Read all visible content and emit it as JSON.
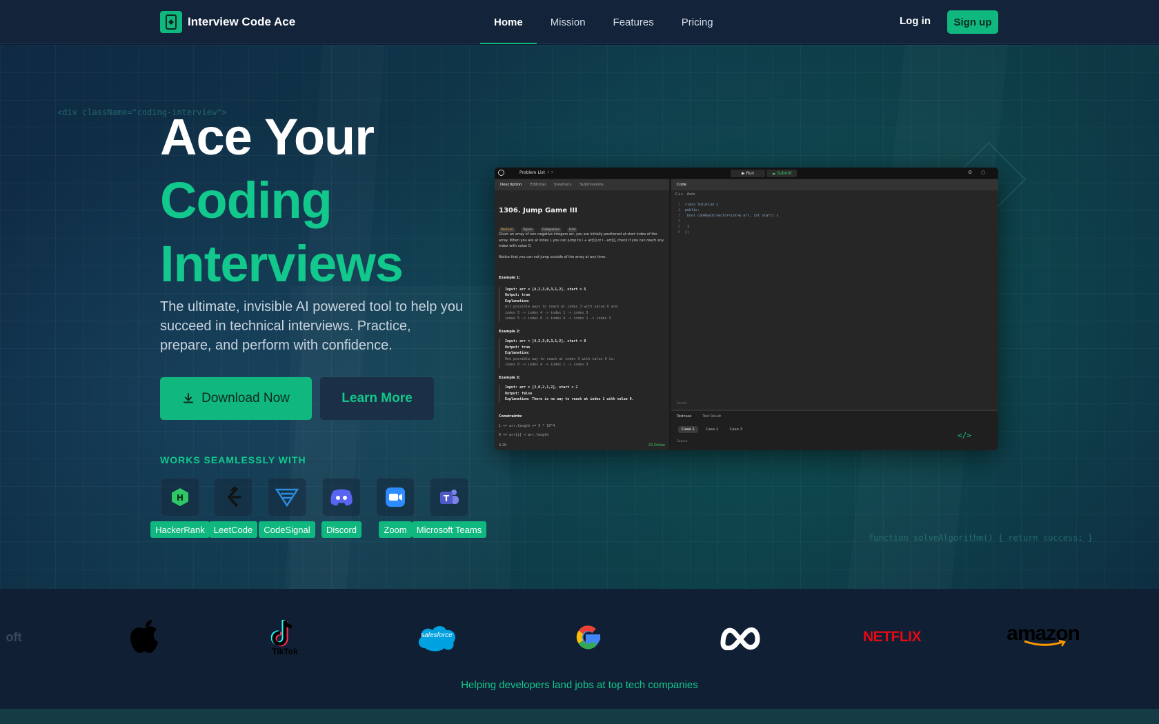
{
  "nav": {
    "brand": "Interview Code Ace",
    "links": [
      "Home",
      "Mission",
      "Features",
      "Pricing"
    ],
    "login": "Log in",
    "signup": "Sign up"
  },
  "hero": {
    "headline_line1": "Ace Your",
    "headline_line2": "Coding",
    "headline_line3": "Interviews",
    "subtitle": "The ultimate, invisible AI powered tool to help you succeed in technical interviews. Practice, prepare, and perform with confidence.",
    "download_label": "Download Now",
    "learn_label": "Learn More",
    "code_deco_1": "<div className=\"coding-interview\">",
    "code_deco_2": "function solveAlgorithm() { return success; }",
    "works_title": "WORKS SEAMLESSLY WITH",
    "platforms": [
      {
        "name": "HackerRank",
        "icon": "hackerrank-icon"
      },
      {
        "name": "LeetCode",
        "icon": "leetcode-icon"
      },
      {
        "name": "CodeSignal",
        "icon": "codesignal-icon"
      },
      {
        "name": "Discord",
        "icon": "discord-icon"
      },
      {
        "name": "Zoom",
        "icon": "zoom-icon"
      },
      {
        "name": "Microsoft Teams",
        "icon": "microsoft-teams-icon"
      }
    ]
  },
  "app": {
    "problem_list": "Problem List",
    "run": "Run",
    "submit": "Submit",
    "left_tabs": [
      "Description",
      "Editorial",
      "Solutions",
      "Submissions"
    ],
    "right_tab": "Code",
    "lang": "C++",
    "auto": "Auto",
    "problem_title": "1306. Jump Game III",
    "pills": [
      "Medium",
      "Topics",
      "Companies",
      "Hint"
    ],
    "desc_1": "Given an array of non-negative integers arr, you are initially positioned at start index of the array. When you are at index i, you can jump to i + arr[i] or i - arr[i], check if you can reach any index with value 0.",
    "desc_2": "Notice that you can not jump outside of the array at any time.",
    "ex1_title": "Example 1:",
    "ex1_input": "Input: arr = [4,2,3,0,3,1,2], start = 5",
    "ex1_output": "Output: true",
    "ex1_expl": "Explanation:",
    "ex1_l1": "All possible ways to reach at index 3 with value 0 are:",
    "ex1_l2": "index 5 -> index 4 -> index 1 -> index 3",
    "ex1_l3": "index 5 -> index 6 -> index 4 -> index 1 -> index 3",
    "ex2_title": "Example 2:",
    "ex2_input": "Input: arr = [4,2,3,0,3,1,2], start = 0",
    "ex2_output": "Output: true",
    "ex2_expl": "Explanation:",
    "ex2_l1": "One possible way to reach at index 3 with value 0 is:",
    "ex2_l2": "index 0 -> index 4 -> index 1 -> index 3",
    "ex3_title": "Example 3:",
    "ex3_input": "Input: arr = [3,0,2,1,2], start = 2",
    "ex3_output": "Output: false",
    "ex3_expl": "Explanation: There is no way to reach at index 1 with value 0.",
    "constraints": "Constraints:",
    "c1": "1 <= arr.length <= 5 * 10^4",
    "c2": "0 <= arr[i] < arr.length",
    "footer_stats": "4.2K",
    "online": "20 Online",
    "code_l1": "class Solution {",
    "code_l2": "public:",
    "code_l3": "    bool canReach(vector<int>& arr, int start) {",
    "code_l4": "",
    "code_l5": "    }",
    "code_l6": "};",
    "saved": "Saved",
    "testcase_tab": "Testcase",
    "testresult_tab": "Test Result",
    "cases": [
      "Case 1",
      "Case 2",
      "Case 3"
    ],
    "source": "Source",
    "code_glyph": "</>"
  },
  "logos": {
    "items": [
      {
        "name": "microsoft-logo",
        "text": "oft"
      },
      {
        "name": "apple-logo",
        "text": ""
      },
      {
        "name": "tiktok-logo",
        "text": "TikTok"
      },
      {
        "name": "salesforce-logo",
        "text": "salesforce"
      },
      {
        "name": "google-logo",
        "text": ""
      },
      {
        "name": "meta-logo",
        "text": ""
      },
      {
        "name": "netflix-logo",
        "text": "NETFLIX"
      },
      {
        "name": "amazon-logo",
        "text": "amazon"
      }
    ],
    "tagline": "Helping developers land jobs at top tech companies"
  },
  "colors": {
    "accent": "#10b77f",
    "accent_text": "#12c88c",
    "nav_bg": "#12233a",
    "strip_bg": "#101f33"
  }
}
